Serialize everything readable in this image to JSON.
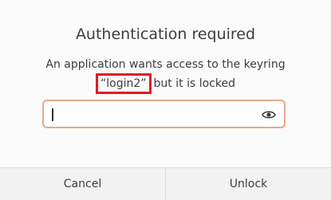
{
  "dialog": {
    "title": "Authentication required",
    "message_line1": "An application wants access to the keyring",
    "keyring_name": "“login2”",
    "message_line2_rest": "but it is locked",
    "password_value": "",
    "reveal_icon": "eye-icon",
    "cancel_label": "Cancel",
    "unlock_label": "Unlock"
  },
  "colors": {
    "background": "#fafafa",
    "field_border": "#e5a88a",
    "highlight_box": "#e01b24",
    "button_bg": "#f2f2f2"
  }
}
